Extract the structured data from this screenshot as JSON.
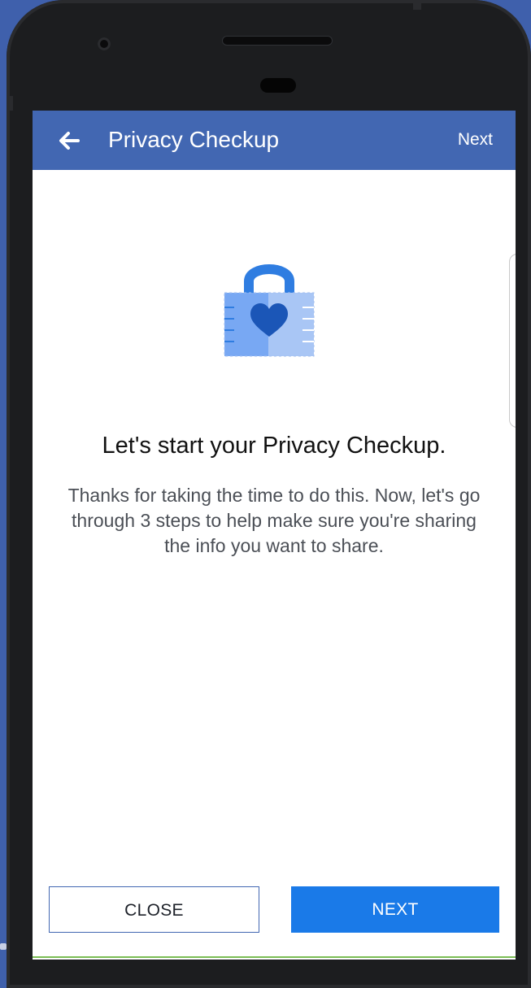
{
  "appbar": {
    "title": "Privacy Checkup",
    "next_label": "Next"
  },
  "intro": {
    "heading": "Let's start your Privacy Checkup.",
    "body": "Thanks for taking the time to do this. Now, let's go through 3 steps to help make sure you're sharing the info you want to share."
  },
  "buttons": {
    "close_label": "CLOSE",
    "next_label": "NEXT"
  },
  "icons": {
    "back": "back-arrow-icon",
    "lock": "lock-heart-icon"
  },
  "colors": {
    "brand": "#4267b2",
    "primary_button": "#1a7ae8",
    "background": "#3f60ac"
  }
}
